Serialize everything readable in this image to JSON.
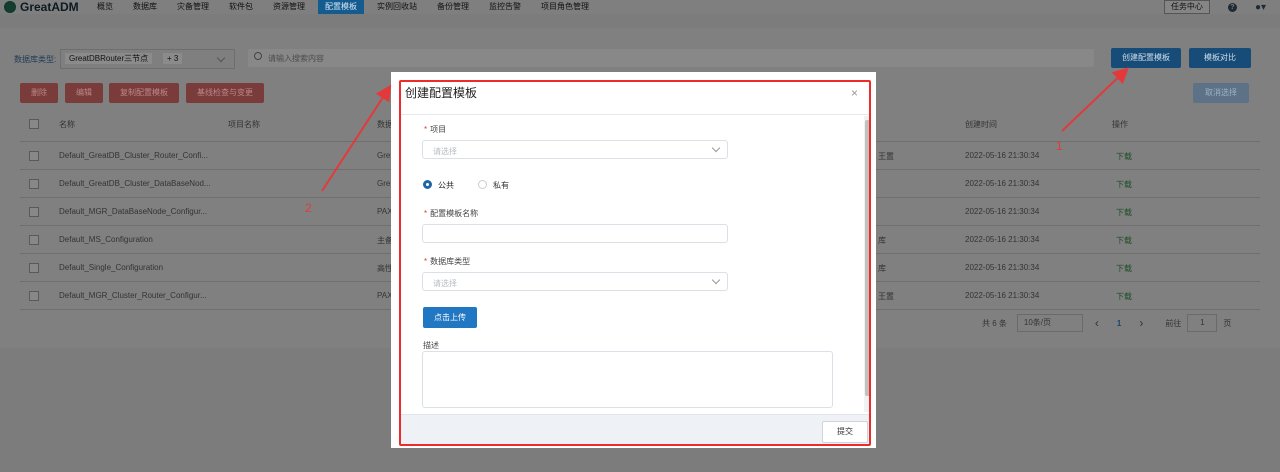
{
  "app": {
    "logo_text": "GreatADM"
  },
  "nav": {
    "items": [
      "概览",
      "数据库",
      "灾备管理",
      "软件包",
      "资源管理",
      "配置模板",
      "实例回收站",
      "备份管理",
      "监控告警",
      "项目角色管理"
    ],
    "active_index": 5,
    "task_center": "任务中心",
    "help_icon": "?",
    "user_icon": "user-icon"
  },
  "filter": {
    "label": "数据库类型:",
    "selected_tag": "GreatDBRouter三节点",
    "more_tag": "+ 3",
    "search_placeholder": "请输入搜索内容"
  },
  "toolbar": {
    "create": "创建配置模板",
    "compare": "模板对比",
    "delete": "删除",
    "edit": "编辑",
    "copy": "复制配置模板",
    "check": "基线检查与变更",
    "cancel_select": "取消选择"
  },
  "table": {
    "headers": {
      "name": "名称",
      "project": "项目名称",
      "db": "数据",
      "created": "创建时间",
      "op": "操作"
    },
    "rows": [
      {
        "name": "Default_GreatDB_Cluster_Router_Confi...",
        "db": "Gre",
        "right": "王置",
        "time": "2022-05-16 21:30:34",
        "op": "下载"
      },
      {
        "name": "Default_GreatDB_Cluster_DataBaseNod...",
        "db": "Gre",
        "right": "",
        "time": "2022-05-16 21:30:34",
        "op": "下载"
      },
      {
        "name": "Default_MGR_DataBaseNode_Configur...",
        "db": "PAX",
        "right": "",
        "time": "2022-05-16 21:30:34",
        "op": "下载"
      },
      {
        "name": "Default_MS_Configuration",
        "db": "主备",
        "right": "库",
        "time": "2022-05-16 21:30:34",
        "op": "下载"
      },
      {
        "name": "Default_Single_Configuration",
        "db": "高性",
        "right": "库",
        "time": "2022-05-16 21:30:34",
        "op": "下载"
      },
      {
        "name": "Default_MGR_Cluster_Router_Configur...",
        "db": "PAX",
        "right": "王置",
        "time": "2022-05-16 21:30:34",
        "op": "下载"
      }
    ]
  },
  "pager": {
    "total": "共 6 条",
    "page_size": "10条/页",
    "prev": "‹",
    "page": "1",
    "next": "›",
    "goto_label": "前往",
    "goto_value": "1",
    "goto_unit": "页"
  },
  "modal": {
    "title": "创建配置模板",
    "close": "×",
    "project_label": "项目",
    "project_placeholder": "请选择",
    "radio_public": "公共",
    "radio_private": "私有",
    "name_label": "配置模板名称",
    "db_type_label": "数据库类型",
    "db_type_placeholder": "请选择",
    "upload": "点击上传",
    "desc_label": "描述",
    "submit": "提交",
    "required_mark": "*"
  },
  "annotations": {
    "label_1": "1",
    "label_2": "2",
    "color": "#e23a3a"
  }
}
